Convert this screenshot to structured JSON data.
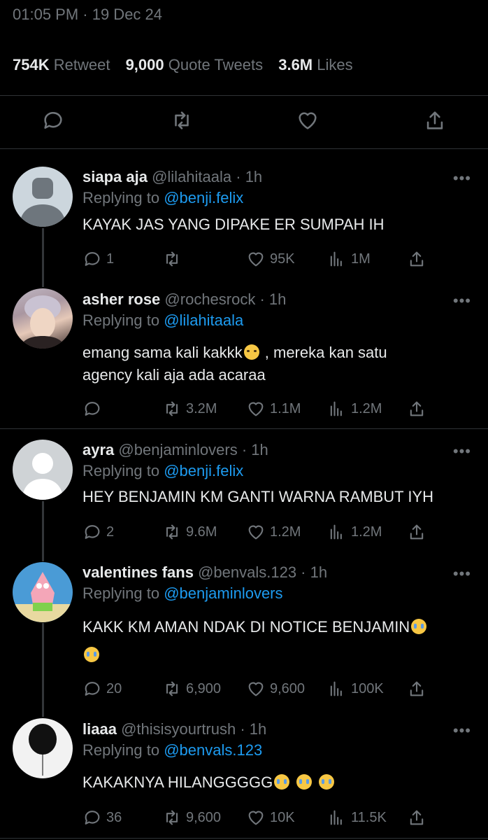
{
  "timestamp": "01:05 PM · 19 Dec 24",
  "stats": {
    "retweets_count": "754K",
    "retweets_label": "Retweet",
    "quotes_count": "9,000",
    "quotes_label": "Quote Tweets",
    "likes_count": "3.6M",
    "likes_label": "Likes"
  },
  "more_glyph": "•••",
  "tweets": [
    {
      "name": "siapa aja",
      "handle": "@lilahitaala · 1h",
      "reply_prefix": "Replying to",
      "reply_to": "@benji.felix",
      "text": "KAYAK JAS YANG DIPAKE ER SUMPAH IH",
      "text2": "",
      "reply_count": "1",
      "retweet_count": "",
      "like_count": "95K",
      "view_count": "1M"
    },
    {
      "name": "asher rose",
      "handle": "@rochesrock · 1h",
      "reply_prefix": "Replying to",
      "reply_to": "@lilahitaala",
      "text": "emang sama kali kakkk",
      "text_after_emoji": " , mereka kan satu",
      "text2": "agency kali aja ada acaraa",
      "reply_count": "",
      "retweet_count": "3.2M",
      "like_count": "1.1M",
      "view_count": "1.2M"
    },
    {
      "name": "ayra",
      "handle": "@benjaminlovers · 1h",
      "reply_prefix": "Replying to",
      "reply_to": "@benji.felix",
      "text": "HEY BENJAMIN KM GANTI WARNA RAMBUT IYH",
      "text2": "",
      "reply_count": "2",
      "retweet_count": "9.6M",
      "like_count": "1.2M",
      "view_count": "1.2M"
    },
    {
      "name": "valentines fans",
      "handle": "@benvals.123 · 1h",
      "reply_prefix": "Replying to",
      "reply_to": "@benjaminlovers",
      "text": "KAKK KM AMAN NDAK DI NOTICE BENJAMIN",
      "text2": "",
      "reply_count": "20",
      "retweet_count": "6,900",
      "like_count": "9,600",
      "view_count": "100K"
    },
    {
      "name": "liaaa",
      "handle": "@thisisyourtrush · 1h",
      "reply_prefix": "Replying to",
      "reply_to": "@benvals.123",
      "text": "KAKAKNYA HILANGGGGG",
      "text2": "",
      "reply_count": "36",
      "retweet_count": "9,600",
      "like_count": "10K",
      "view_count": "11.5K"
    }
  ]
}
